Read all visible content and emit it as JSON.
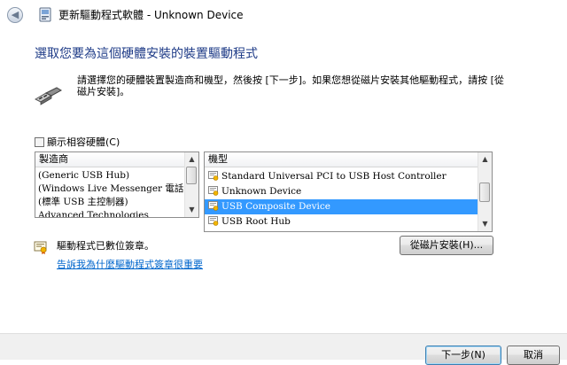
{
  "window": {
    "title": "更新驅動程式軟體 - Unknown Device",
    "back_icon": "back-arrow-icon"
  },
  "heading": "選取您要為這個硬體安裝的裝置驅動程式",
  "instruction": "請選擇您的硬體裝置製造商和機型，然後按 [下一步]。如果您想從磁片安裝其他驅動程式，請按 [從磁片安裝]。",
  "show_compatible": {
    "label": "顯示相容硬體(C)",
    "checked": false
  },
  "manufacturer_list": {
    "header": "製造商",
    "items": [
      "(Generic USB Hub)",
      "(Windows Live Messenger 電話)",
      "(標準 USB 主控制器)",
      "Advanced Technologies"
    ]
  },
  "model_list": {
    "header": "機型",
    "items": [
      {
        "label": "Standard Universal PCI to USB Host Controller",
        "selected": false
      },
      {
        "label": "Unknown Device",
        "selected": false
      },
      {
        "label": "USB Composite Device",
        "selected": true
      },
      {
        "label": "USB Root Hub",
        "selected": false
      }
    ]
  },
  "signed_text": "驅動程式已數位簽章。",
  "signing_link": "告訴我為什麼驅動程式簽章很重要",
  "buttons": {
    "have_disk": "從磁片安裝(H)...",
    "next": "下一步(N)",
    "cancel": "取消"
  },
  "colors": {
    "heading": "#1e3b87",
    "link": "#0066cc",
    "selection": "#3399ff"
  }
}
